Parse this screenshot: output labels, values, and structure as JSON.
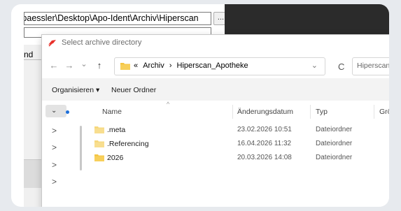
{
  "background_window": {
    "path_value": "e\\baessler\\Desktop\\Apo-Ident\\Archiv\\Hiperscan",
    "browse_label": "...",
    "partial_label": "nd"
  },
  "dialog": {
    "title": "Select archive directory",
    "nav": {
      "back": "←",
      "forward": "→",
      "recent": "⌄",
      "up": "↑"
    },
    "address": {
      "prefix": "«",
      "crumb_1": "Archiv",
      "separator": "›",
      "crumb_2": "Hiperscan_Apotheke",
      "dropdown": "⌄"
    },
    "refresh": "C",
    "search_placeholder": "Hiperscan_Apotheke",
    "toolbar": {
      "organize": "Organisieren ▾",
      "new_folder": "Neuer Ordner"
    },
    "columns": {
      "name": "Name",
      "sort_caret": "^",
      "date": "Änderungsdatum",
      "type": "Typ",
      "size": "Größ"
    },
    "nav_pane": {
      "selected_chevron": "⌄",
      "chevrons": [
        ">",
        ">",
        ">",
        ">"
      ]
    },
    "files": [
      {
        "name": ".meta",
        "date": "23.02.2026 10:51",
        "type": "Dateiordner"
      },
      {
        "name": ".Referencing",
        "date": "16.04.2026 11:32",
        "type": "Dateiordner"
      },
      {
        "name": "2026",
        "date": "20.03.2026 14:08",
        "type": "Dateiordner"
      }
    ]
  },
  "colors": {
    "folder": "#f4c542",
    "accent": "#1e6fd9",
    "app_icon": "#e8322c"
  }
}
